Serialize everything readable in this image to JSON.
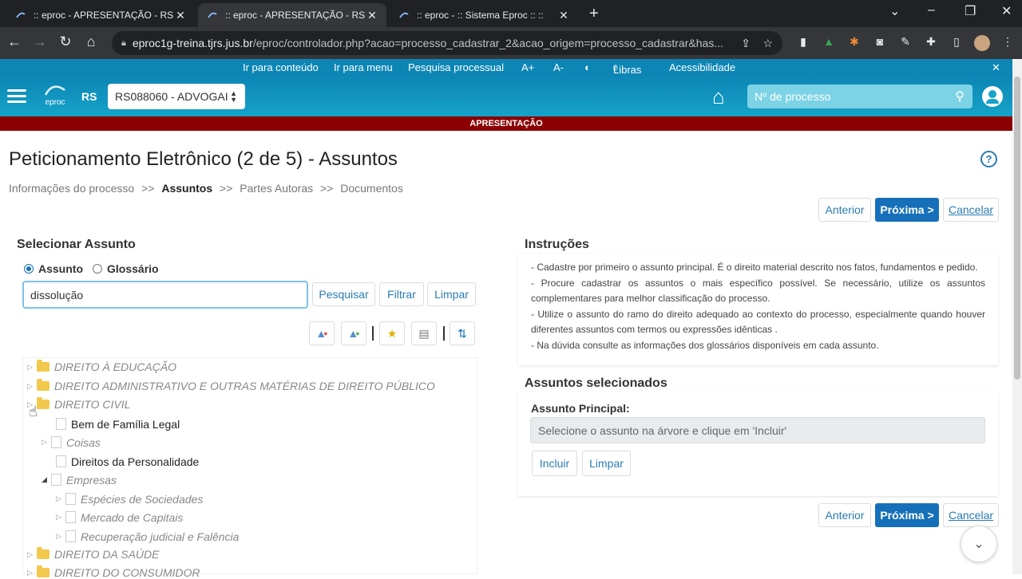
{
  "browser": {
    "tabs": [
      {
        "title": ":: eproc - APRESENTAÇÃO - RS - ",
        "active": false
      },
      {
        "title": ":: eproc - APRESENTAÇÃO - RS - ",
        "active": true
      },
      {
        "title": ":: eproc - :: Sistema Eproc :: ::",
        "active": false
      }
    ],
    "new_tab": "+",
    "url_host": "eproc1g-treina.tjrs.jus.br",
    "url_path": "/eproc/controlador.php?acao=processo_cadastrar_2&acao_origem=processo_cadastrar&has..."
  },
  "accessibility_bar": {
    "items": [
      "Ir para conteúdo",
      "Ir para menu",
      "Pesquisa processual",
      "A+",
      "A-",
      "◐",
      "Libras",
      "Acessibilidade"
    ],
    "close": "✕"
  },
  "header": {
    "logo": "eproc",
    "state": "RS",
    "profile_select": "RS088060 - ADVOGAI",
    "search_placeholder": "Nº de processo"
  },
  "banner": "APRESENTAÇÃO",
  "page": {
    "title": "Peticionamento Eletrônico (2 de 5) - Assuntos",
    "breadcrumb": [
      "Informações do processo",
      ">>",
      "Assuntos",
      ">>",
      "Partes Autoras",
      ">>",
      "Documentos"
    ],
    "help_icon": "?"
  },
  "nav_buttons": {
    "previous": "Anterior",
    "next": "Próxima >",
    "cancel": "Cancelar"
  },
  "select_subject": {
    "heading": "Selecionar Assunto",
    "radio_subject": "Assunto",
    "radio_glossary": "Glossário",
    "search_value": "dissolução",
    "search_btn": "Pesquisar",
    "filter_btn": "Filtrar",
    "clear_btn": "Limpar"
  },
  "tree": [
    {
      "label": "DIREITO À EDUCAÇÃO"
    },
    {
      "label": "DIREITO ADMINISTRATIVO E OUTRAS MATÉRIAS DE DIREITO PÚBLICO"
    },
    {
      "label": "DIREITO CIVIL"
    },
    {
      "label": "Bem de Família Legal"
    },
    {
      "label": "Coisas"
    },
    {
      "label": "Direitos da Personalidade"
    },
    {
      "label": "Empresas"
    },
    {
      "label": "Espécies de Sociedades"
    },
    {
      "label": "Mercado de Capitais"
    },
    {
      "label": "Recuperação judicial e Falência"
    },
    {
      "label": "DIREITO DA SAÚDE"
    },
    {
      "label": "DIREITO DO CONSUMIDOR"
    }
  ],
  "instructions": {
    "heading": "Instruções",
    "lines": [
      "- Cadastre por primeiro o assunto principal. É o direito material descrito nos fatos, fundamentos e pedido.",
      "- Procure cadastrar os assuntos o mais específico possível. Se necessário, utilize os assuntos complementares para melhor classificação do processo.",
      "- Utilize o assunto do ramo do direito adequado ao contexto do processo, especialmente quando houver diferentes assuntos com termos ou expressões idênticas .",
      "- Na dúvida consulte as informações dos glossários disponíveis em cada assunto."
    ]
  },
  "selected": {
    "heading": "Assuntos selecionados",
    "principal_label": "Assunto Principal:",
    "principal_placeholder": "Selecione o assunto na árvore e clique em 'Incluir'",
    "include_btn": "Incluir",
    "clear_btn": "Limpar"
  },
  "colors": {
    "accent": "#1670b9",
    "header": "#0d86b5",
    "banner": "#8b0000"
  }
}
